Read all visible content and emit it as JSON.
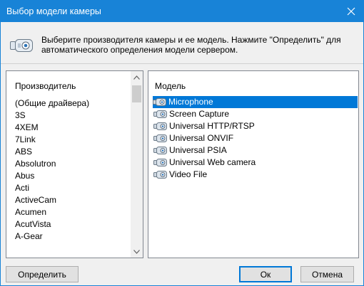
{
  "window": {
    "title": "Выбор модели камеры",
    "close_icon": "close-icon",
    "accent": "#1883d7"
  },
  "info": {
    "icon": "camera-icon",
    "text_line1": "Выберите производителя камеры и ее модель. Нажмите \"Определить\" для",
    "text_line2": "автоматического определения модели сервером."
  },
  "manufacturers": {
    "header": "Производитель",
    "items": [
      "(Общие драйвера)",
      "3S",
      "4XEM",
      "7Link",
      "ABS",
      "Absolutron",
      "Abus",
      "Acti",
      "ActiveCam",
      "Acumen",
      "AcutVista",
      "A-Gear"
    ]
  },
  "models": {
    "header": "Модель",
    "items": [
      "Microphone",
      "Screen Capture",
      "Universal HTTP/RTSP",
      "Universal ONVIF",
      "Universal PSIA",
      "Universal Web camera",
      "Video File"
    ],
    "selected": "Microphone",
    "selection_color": "#0078d7"
  },
  "buttons": {
    "detect": "Определить",
    "ok": "Ок",
    "cancel": "Отмена"
  }
}
